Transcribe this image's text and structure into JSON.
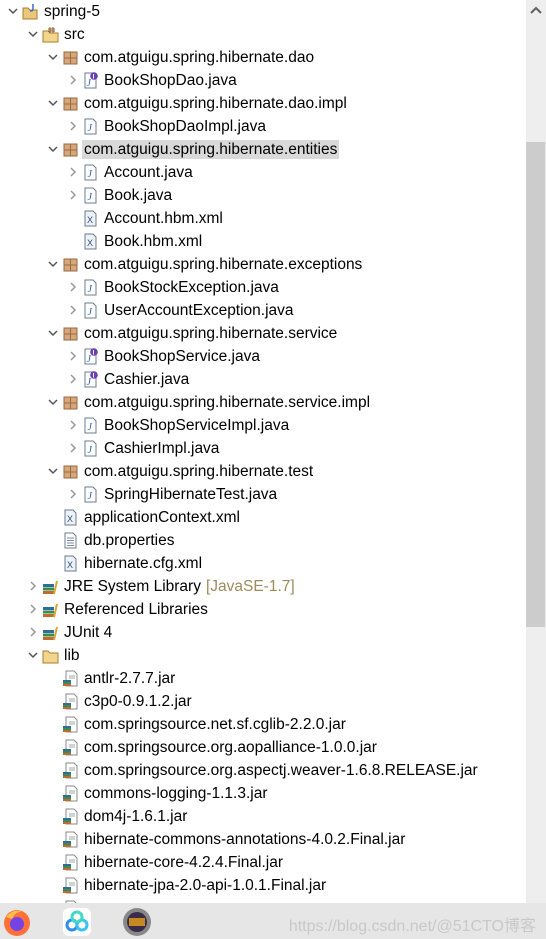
{
  "tree": [
    {
      "level": 0,
      "state": "expanded",
      "icon": "project-icon",
      "label": "spring-5"
    },
    {
      "level": 1,
      "state": "expanded",
      "icon": "source-folder-icon",
      "label": "src"
    },
    {
      "level": 2,
      "state": "expanded",
      "icon": "package-icon",
      "label": "com.atguigu.spring.hibernate.dao"
    },
    {
      "level": 3,
      "state": "collapsed",
      "icon": "java-interface-icon",
      "label": "BookShopDao.java"
    },
    {
      "level": 2,
      "state": "expanded",
      "icon": "package-icon",
      "label": "com.atguigu.spring.hibernate.dao.impl"
    },
    {
      "level": 3,
      "state": "collapsed",
      "icon": "java-class-icon",
      "label": "BookShopDaoImpl.java"
    },
    {
      "level": 2,
      "state": "expanded",
      "icon": "package-icon",
      "label": "com.atguigu.spring.hibernate.entities",
      "selected": true
    },
    {
      "level": 3,
      "state": "collapsed",
      "icon": "java-class-icon",
      "label": "Account.java"
    },
    {
      "level": 3,
      "state": "collapsed",
      "icon": "java-class-icon",
      "label": "Book.java"
    },
    {
      "level": 3,
      "state": "none",
      "icon": "xml-file-icon",
      "label": "Account.hbm.xml"
    },
    {
      "level": 3,
      "state": "none",
      "icon": "xml-file-icon",
      "label": "Book.hbm.xml"
    },
    {
      "level": 2,
      "state": "expanded",
      "icon": "package-icon",
      "label": "com.atguigu.spring.hibernate.exceptions"
    },
    {
      "level": 3,
      "state": "collapsed",
      "icon": "java-class-icon",
      "label": "BookStockException.java"
    },
    {
      "level": 3,
      "state": "collapsed",
      "icon": "java-class-icon",
      "label": "UserAccountException.java"
    },
    {
      "level": 2,
      "state": "expanded",
      "icon": "package-icon",
      "label": "com.atguigu.spring.hibernate.service"
    },
    {
      "level": 3,
      "state": "collapsed",
      "icon": "java-interface-icon",
      "label": "BookShopService.java"
    },
    {
      "level": 3,
      "state": "collapsed",
      "icon": "java-interface-icon",
      "label": "Cashier.java"
    },
    {
      "level": 2,
      "state": "expanded",
      "icon": "package-icon",
      "label": "com.atguigu.spring.hibernate.service.impl"
    },
    {
      "level": 3,
      "state": "collapsed",
      "icon": "java-class-icon",
      "label": "BookShopServiceImpl.java"
    },
    {
      "level": 3,
      "state": "collapsed",
      "icon": "java-class-icon",
      "label": "CashierImpl.java"
    },
    {
      "level": 2,
      "state": "expanded",
      "icon": "package-icon",
      "label": "com.atguigu.spring.hibernate.test"
    },
    {
      "level": 3,
      "state": "collapsed",
      "icon": "java-class-icon",
      "label": "SpringHibernateTest.java"
    },
    {
      "level": 2,
      "state": "none",
      "icon": "xml-file-icon",
      "label": "applicationContext.xml"
    },
    {
      "level": 2,
      "state": "none",
      "icon": "text-file-icon",
      "label": "db.properties"
    },
    {
      "level": 2,
      "state": "none",
      "icon": "xml-file-icon",
      "label": "hibernate.cfg.xml"
    },
    {
      "level": 1,
      "state": "collapsed",
      "icon": "library-icon",
      "label": "JRE System Library",
      "decoration": "[JavaSE-1.7]"
    },
    {
      "level": 1,
      "state": "collapsed",
      "icon": "library-icon",
      "label": "Referenced Libraries"
    },
    {
      "level": 1,
      "state": "collapsed",
      "icon": "library-icon",
      "label": "JUnit 4"
    },
    {
      "level": 1,
      "state": "expanded",
      "icon": "folder-icon",
      "label": "lib"
    },
    {
      "level": 2,
      "state": "none",
      "icon": "jar-icon",
      "label": "antlr-2.7.7.jar"
    },
    {
      "level": 2,
      "state": "none",
      "icon": "jar-icon",
      "label": "c3p0-0.9.1.2.jar"
    },
    {
      "level": 2,
      "state": "none",
      "icon": "jar-icon",
      "label": "com.springsource.net.sf.cglib-2.2.0.jar"
    },
    {
      "level": 2,
      "state": "none",
      "icon": "jar-icon",
      "label": "com.springsource.org.aopalliance-1.0.0.jar"
    },
    {
      "level": 2,
      "state": "none",
      "icon": "jar-icon",
      "label": "com.springsource.org.aspectj.weaver-1.6.8.RELEASE.jar"
    },
    {
      "level": 2,
      "state": "none",
      "icon": "jar-icon",
      "label": "commons-logging-1.1.3.jar"
    },
    {
      "level": 2,
      "state": "none",
      "icon": "jar-icon",
      "label": "dom4j-1.6.1.jar"
    },
    {
      "level": 2,
      "state": "none",
      "icon": "jar-icon",
      "label": "hibernate-commons-annotations-4.0.2.Final.jar"
    },
    {
      "level": 2,
      "state": "none",
      "icon": "jar-icon",
      "label": "hibernate-core-4.2.4.Final.jar"
    },
    {
      "level": 2,
      "state": "none",
      "icon": "jar-icon",
      "label": "hibernate-jpa-2.0-api-1.0.1.Final.jar"
    },
    {
      "level": 2,
      "state": "none",
      "icon": "jar-icon",
      "label": ""
    }
  ],
  "colors": {
    "selection": "#d9d9d9",
    "decoration": "#a08a5b",
    "package": "#a0714f",
    "interface_badge": "#6a3fb5"
  },
  "taskbar": {
    "icons": [
      "firefox-icon",
      "baidu-netdisk-icon",
      "java-ee-ide-icon"
    ],
    "watermark": "https://blog.csdn.net/@51CTO博客"
  }
}
